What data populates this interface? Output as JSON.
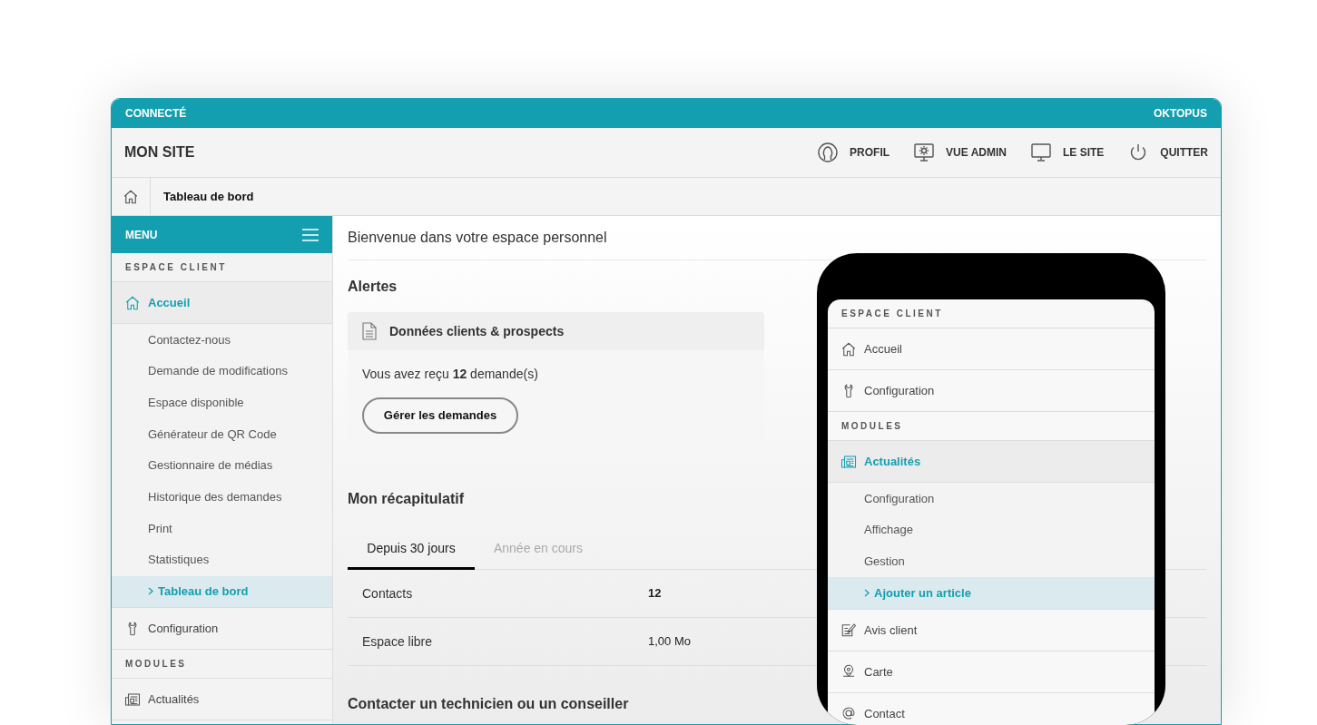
{
  "top_bar": {
    "status": "CONNECTÉ",
    "brand": "OKTOPUS"
  },
  "header": {
    "site_title": "MON SITE",
    "nav": [
      {
        "label": "PROFIL"
      },
      {
        "label": "VUE ADMIN"
      },
      {
        "label": "LE SITE"
      },
      {
        "label": "QUITTER"
      }
    ]
  },
  "breadcrumb": {
    "label": "Tableau de bord"
  },
  "sidebar": {
    "title": "MENU",
    "items": [
      {
        "kind": "section",
        "label": "ESPACE CLIENT"
      },
      {
        "kind": "item",
        "label": "Accueil",
        "expanded": true,
        "children": [
          {
            "label": "Contactez-nous",
            "selected": false
          },
          {
            "label": "Demande de modifications",
            "selected": false
          },
          {
            "label": "Espace disponible",
            "selected": false
          },
          {
            "label": "Générateur de QR Code",
            "selected": false
          },
          {
            "label": "Gestionnaire de médias",
            "selected": false
          },
          {
            "label": "Historique des demandes",
            "selected": false
          },
          {
            "label": "Print",
            "selected": false
          },
          {
            "label": "Statistiques",
            "selected": false
          },
          {
            "label": "Tableau de bord",
            "selected": true
          }
        ]
      },
      {
        "kind": "item",
        "label": "Configuration",
        "expanded": false
      },
      {
        "kind": "section",
        "label": "MODULES"
      },
      {
        "kind": "item",
        "label": "Actualités",
        "expanded": false
      }
    ]
  },
  "main": {
    "welcome": "Bienvenue dans votre espace personnel",
    "alerts_title": "Alertes",
    "alert_card": {
      "title": "Données clients & prospects",
      "message": "Vous avez reçu **12** demande(s)",
      "button": "Gérer les demandes"
    },
    "summary_title": "Mon récapitulatif",
    "tabs": [
      {
        "label": "Depuis 30 jours",
        "selected": true
      },
      {
        "label": "Année en cours",
        "selected": false
      }
    ],
    "rows": [
      {
        "label": "Contacts",
        "value": "12",
        "bold": true
      },
      {
        "label": "Espace libre",
        "value": "1,00 Mo",
        "bold": false
      }
    ],
    "contact_title": "Contacter un technicien ou un conseiller"
  },
  "phone": {
    "items": [
      {
        "kind": "section",
        "label": "ESPACE CLIENT"
      },
      {
        "kind": "item",
        "label": "Accueil",
        "expanded": false
      },
      {
        "kind": "item",
        "label": "Configuration",
        "expanded": false
      },
      {
        "kind": "section",
        "label": "MODULES"
      },
      {
        "kind": "item",
        "label": "Actualités",
        "expanded": true,
        "children": [
          {
            "label": "Configuration",
            "selected": false
          },
          {
            "label": "Affichage",
            "selected": false
          },
          {
            "label": "Gestion",
            "selected": false
          },
          {
            "label": "Ajouter un article",
            "selected": true
          }
        ]
      },
      {
        "kind": "item",
        "label": "Avis client",
        "expanded": false
      },
      {
        "kind": "item",
        "label": "Carte",
        "expanded": false
      },
      {
        "kind": "item",
        "label": "Contact",
        "expanded": false
      }
    ]
  }
}
